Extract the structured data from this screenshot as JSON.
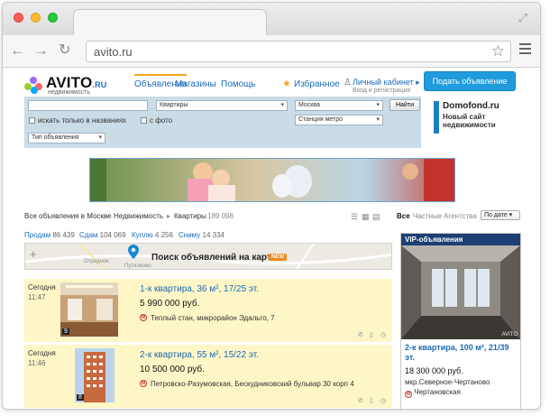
{
  "browser": {
    "url": "avito.ru"
  },
  "header": {
    "logo_text": "AVITO",
    "logo_suffix": ".RU",
    "logo_sub": "недвижимость",
    "nav": [
      "Объявления",
      "Магазины",
      "Помощь"
    ],
    "favorites": "Избранное",
    "cabinet": "Личный кабинет",
    "cabinet_sub": "Вход и регистрация",
    "post_button": "Подать объявление"
  },
  "search": {
    "query": "",
    "category": "Квартиры",
    "city": "Москва",
    "find_button": "Найти",
    "titles_only": "искать только в названиях",
    "with_photo": "с фото",
    "metro": "Станция метро",
    "ad_type": "Тип объявления"
  },
  "promo": {
    "brand": "Domofond.ru",
    "text": "Новый сайт недвижимости"
  },
  "breadcrumb": {
    "all": "Все объявления в Москве",
    "realty": "Недвижимость",
    "flats": "Квартиры",
    "count": "189 098"
  },
  "filters": {
    "all": "Все",
    "private": "Частные",
    "agency": "Агентства",
    "sort": "По дате"
  },
  "categories": [
    {
      "label": "Продам",
      "count": "86 439"
    },
    {
      "label": "Сдам",
      "count": "104 069"
    },
    {
      "label": "Куплю",
      "count": "4 256"
    },
    {
      "label": "Сниму",
      "count": "14 334"
    }
  ],
  "map": {
    "title": "Поиск объявлений на карте",
    "badge": "NEW",
    "towns": [
      "Отрадное",
      "Путилково"
    ]
  },
  "listings": [
    {
      "date": "Сегодня",
      "time": "11:47",
      "photos": "9",
      "title": "1-к квартира, 36 м², 17/25 эт.",
      "price": "5 990 000 руб.",
      "address": "Теплый стан, микрорайон Эдальго, 7"
    },
    {
      "date": "Сегодня",
      "time": "11:46",
      "photos": "8",
      "title": "2-к квартира, 55 м², 15/22 эт.",
      "price": "10 500 000 руб.",
      "address": "Петровско-Разумовская, Бескудниковский бульвар 30 корп 4"
    }
  ],
  "vip": {
    "header": "VIP-объявления",
    "watermark": "AVITO",
    "title": "2-к квартира, 100 м², 21/39 эт.",
    "price": "18 300 000 руб.",
    "address": "мкр.Северное-Чертаново",
    "metro": "Чертановская"
  },
  "colors": {
    "brand_blue": "#1a6bb8",
    "post_button": "#1f9bde",
    "search_bg": "#c9dce8",
    "listing_bg": "#fff6c8",
    "vip_header": "#1d3f72",
    "accent_orange": "#f5a623"
  },
  "icons": [
    "back-arrow-icon",
    "forward-arrow-icon",
    "reload-icon",
    "star-icon",
    "menu-icon",
    "user-icon",
    "map-pin-icon",
    "metro-icon",
    "phone-icon",
    "bookmark-icon",
    "clock-icon"
  ]
}
